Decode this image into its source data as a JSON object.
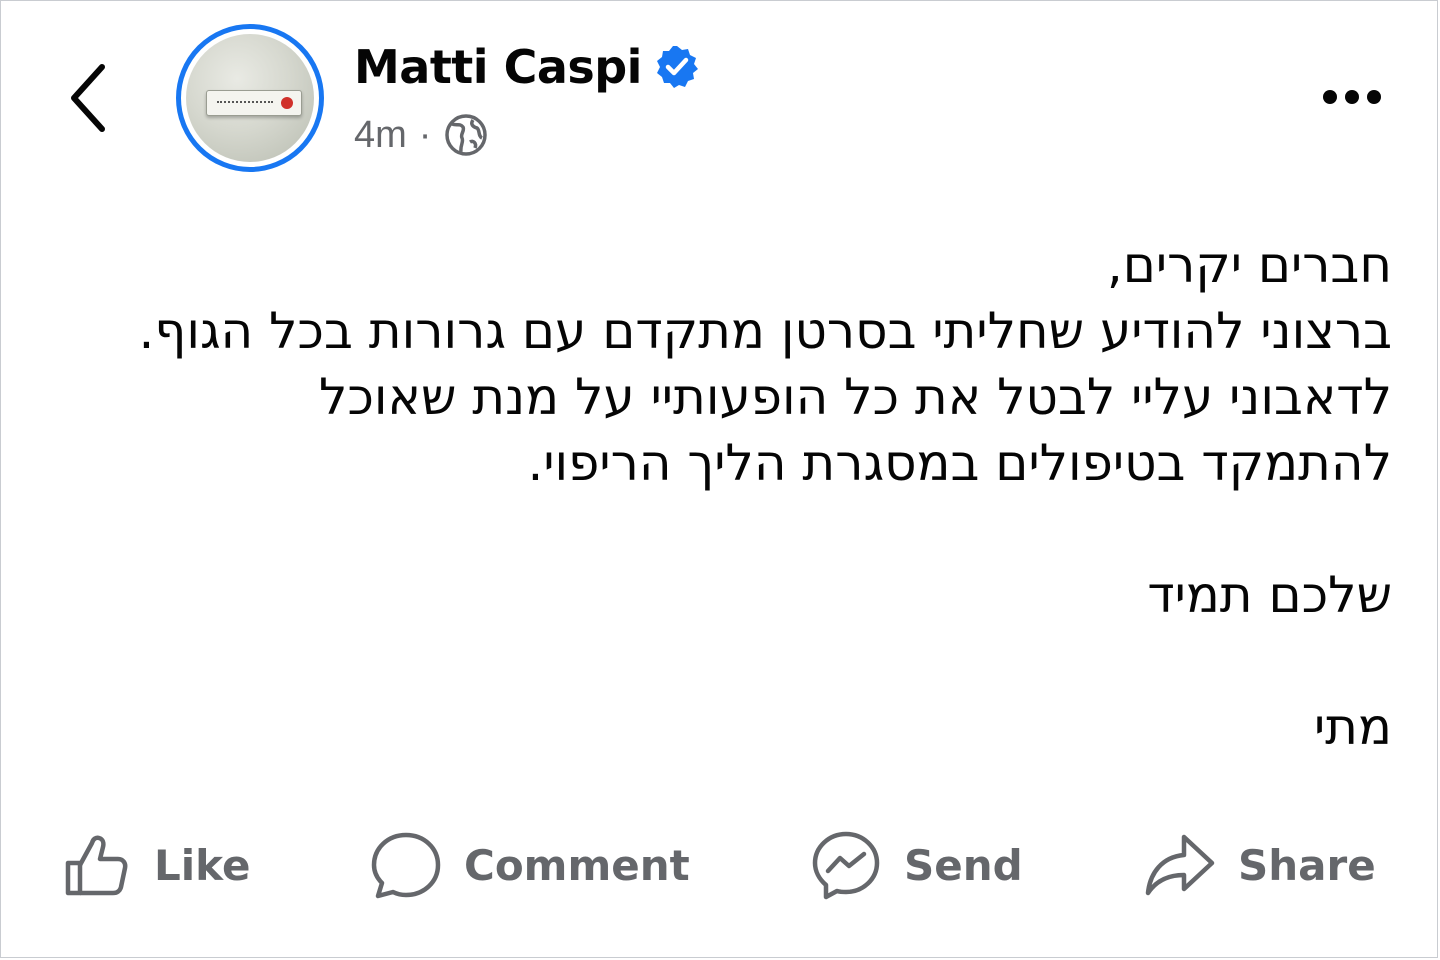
{
  "header": {
    "back_icon": "chevron-left-icon",
    "author_name": "Matti Caspi",
    "verified_icon": "verified-badge-icon",
    "timestamp": "4m",
    "separator": "·",
    "audience_icon": "globe-icon",
    "more_icon": "more-horizontal-icon"
  },
  "post": {
    "lines": [
      "חברים יקרים,",
      "ברצוני להודיע שחליתי בסרטן מתקדם עם גרורות בכל הגוף.",
      "לדאבוני עליי לבטל את כל הופעותיי על מנת שאוכל",
      "להתמקד בטיפולים במסגרת הליך הריפוי."
    ],
    "signoff": "שלכם תמיד",
    "signature": "מתי"
  },
  "actions": {
    "like": {
      "label": "Like",
      "icon": "thumbs-up-icon"
    },
    "comment": {
      "label": "Comment",
      "icon": "comment-bubble-icon"
    },
    "send": {
      "label": "Send",
      "icon": "messenger-icon"
    },
    "share": {
      "label": "Share",
      "icon": "share-arrow-icon"
    }
  },
  "colors": {
    "accent": "#1877f2",
    "text": "#050505",
    "secondary_text": "#65676b",
    "background": "#ffffff"
  }
}
